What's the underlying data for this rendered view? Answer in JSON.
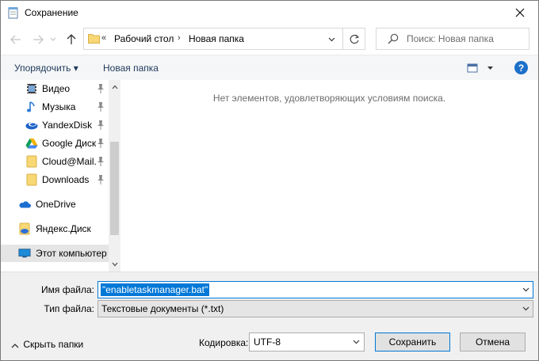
{
  "window": {
    "title": "Сохранение"
  },
  "address": {
    "segments": [
      "Рабочий стол",
      "Новая папка"
    ],
    "overflow": "«"
  },
  "search": {
    "placeholder": "Поиск: Новая папка"
  },
  "toolbar": {
    "organize_label": "Упорядочить ▾",
    "new_folder_label": "Новая папка",
    "help_label": "?"
  },
  "nav": {
    "items": [
      {
        "label": "Видео",
        "icon": "video-icon"
      },
      {
        "label": "Музыка",
        "icon": "music-icon"
      },
      {
        "label": "YandexDisk",
        "icon": "yandexdisk-icon"
      },
      {
        "label": "Google Диск",
        "icon": "google-drive-icon"
      },
      {
        "label": "Cloud@Mail.",
        "icon": "folder-icon"
      },
      {
        "label": "Downloads",
        "icon": "folder-icon"
      },
      {
        "label": "OneDrive",
        "icon": "onedrive-icon"
      },
      {
        "label": "Яндекс.Диск",
        "icon": "yandex-disk-icon"
      },
      {
        "label": "Этот компьютер",
        "icon": "computer-icon"
      }
    ]
  },
  "content": {
    "empty_message": "Нет элементов, удовлетворяющих условиям поиска."
  },
  "form": {
    "filename_label": "Имя файла:",
    "filename_value": "\"enabletaskmanager.bat\"",
    "filetype_label": "Тип файла:",
    "filetype_value": "Текстовые документы (*.txt)",
    "encoding_label": "Кодировка:",
    "encoding_value": "UTF-8"
  },
  "footer": {
    "hide_folders_label": "Скрыть папки",
    "save_label": "Сохранить",
    "cancel_label": "Отмена"
  },
  "colors": {
    "accent": "#0078d7",
    "help": "#1c70c9",
    "toolbar_text": "#1e395b"
  }
}
